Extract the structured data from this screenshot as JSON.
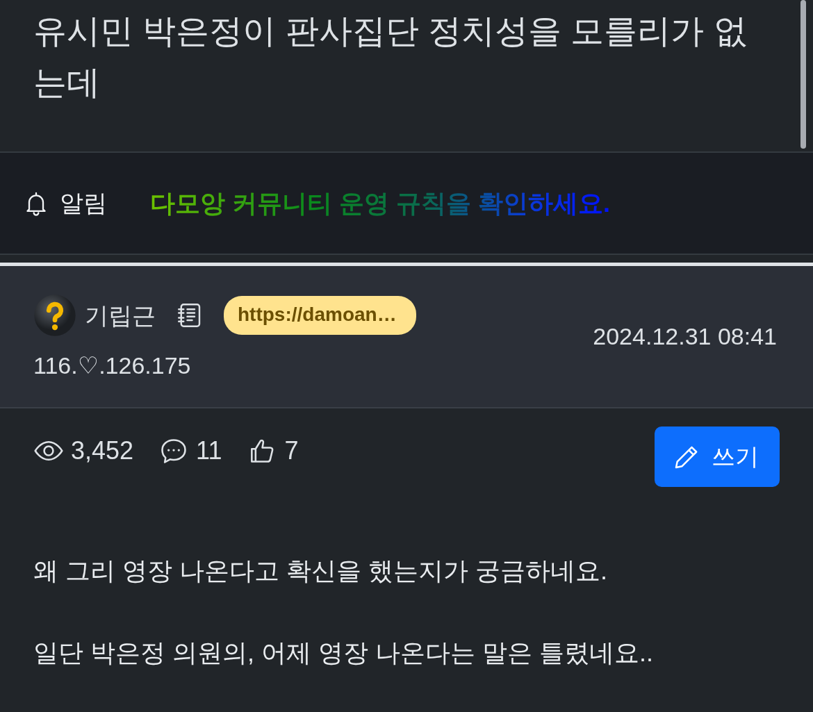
{
  "post": {
    "title": "유시민 박은정이 판사집단 정치성을 모를리가 없는데"
  },
  "notice": {
    "label": "알림",
    "message": "다모앙 커뮤니티 운영 규칙을 확인하세요."
  },
  "author": {
    "name": "기립근",
    "link": "https://damoan…",
    "ip": "116.♡.126.175",
    "date": "2024.12.31 08:41"
  },
  "stats": {
    "views": "3,452",
    "comments": "11",
    "likes": "7"
  },
  "write_button": "쓰기",
  "body": [
    "왜 그리 영장 나온다고 확신을 했는지가 궁금하네요.",
    "일단 박은정 의원의, 어제 영장 나온다는 말은 틀렸네요.."
  ]
}
